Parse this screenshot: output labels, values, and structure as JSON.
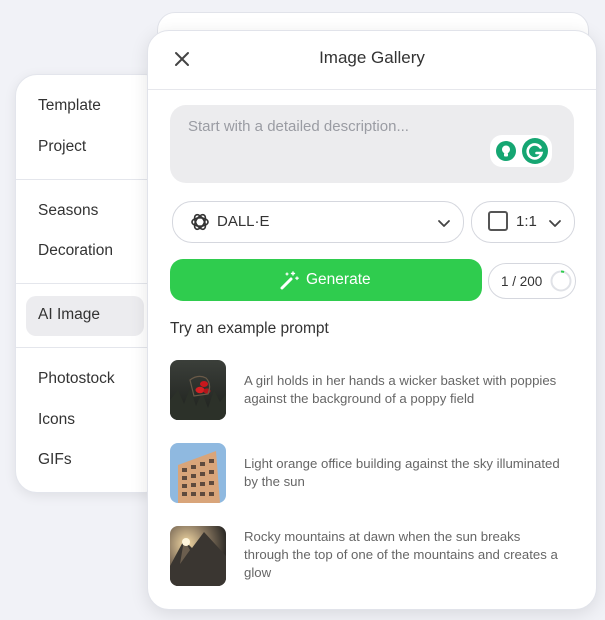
{
  "sidebar": {
    "items": [
      {
        "label": "Template"
      },
      {
        "label": "Project"
      },
      {
        "label": "Seasons"
      },
      {
        "label": "Decoration"
      },
      {
        "label": "AI Image",
        "active": true
      },
      {
        "label": "Photostock"
      },
      {
        "label": "Icons"
      },
      {
        "label": "GIFs"
      }
    ]
  },
  "dialog": {
    "title": "Image Gallery",
    "close_icon": "close-icon",
    "prompt": {
      "placeholder": "Start with a detailed description...",
      "value": ""
    },
    "model": {
      "label": "DALL·E",
      "icon": "openai-logo-icon"
    },
    "ratio": {
      "label": "1:1",
      "icon": "square-ratio-icon"
    },
    "generate": {
      "label": "Generate",
      "icon": "magic-wand-icon"
    },
    "counter": {
      "label": "1 / 200"
    },
    "examples_heading": "Try an example prompt",
    "examples": [
      {
        "text": "A girl holds in her hands a wicker basket with poppies against the background of a poppy field"
      },
      {
        "text": "Light orange office building against the sky illuminated by the sun"
      },
      {
        "text": "Rocky mountains at dawn when the sun breaks through the top of one of the mountains and creates a glow"
      }
    ]
  },
  "colors": {
    "accent_green": "#2fcc4e",
    "background": "#f1f2f7",
    "grammarly_green": "#15a672"
  }
}
